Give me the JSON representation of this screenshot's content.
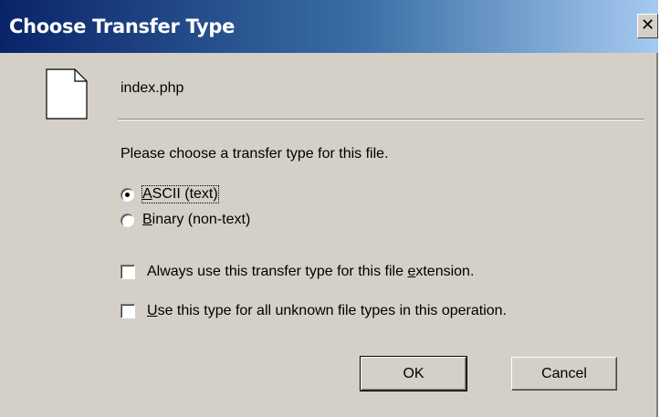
{
  "dialog": {
    "title": "Choose Transfer Type",
    "close_glyph": "✕"
  },
  "file": {
    "name": "index.php",
    "icon": "document-icon"
  },
  "prompt": "Please choose a transfer type for this file.",
  "transfer_types": [
    {
      "label_prefix": "",
      "mnemonic": "A",
      "label_rest": "SCII (text)",
      "checked": true
    },
    {
      "label_prefix": "",
      "mnemonic": "B",
      "label_rest": "inary (non-text)",
      "checked": false
    }
  ],
  "options": [
    {
      "label_prefix": "Always use this transfer type for this file ",
      "mnemonic": "e",
      "label_rest": "xtension.",
      "checked": false
    },
    {
      "label_prefix": "",
      "mnemonic": "U",
      "label_rest": "se this type for all unknown file types in this operation.",
      "checked": false
    }
  ],
  "buttons": {
    "ok": "OK",
    "cancel": "Cancel"
  },
  "colors": {
    "title_start": "#0a246a",
    "title_end": "#a6caf0",
    "face": "#d4d0c8"
  }
}
